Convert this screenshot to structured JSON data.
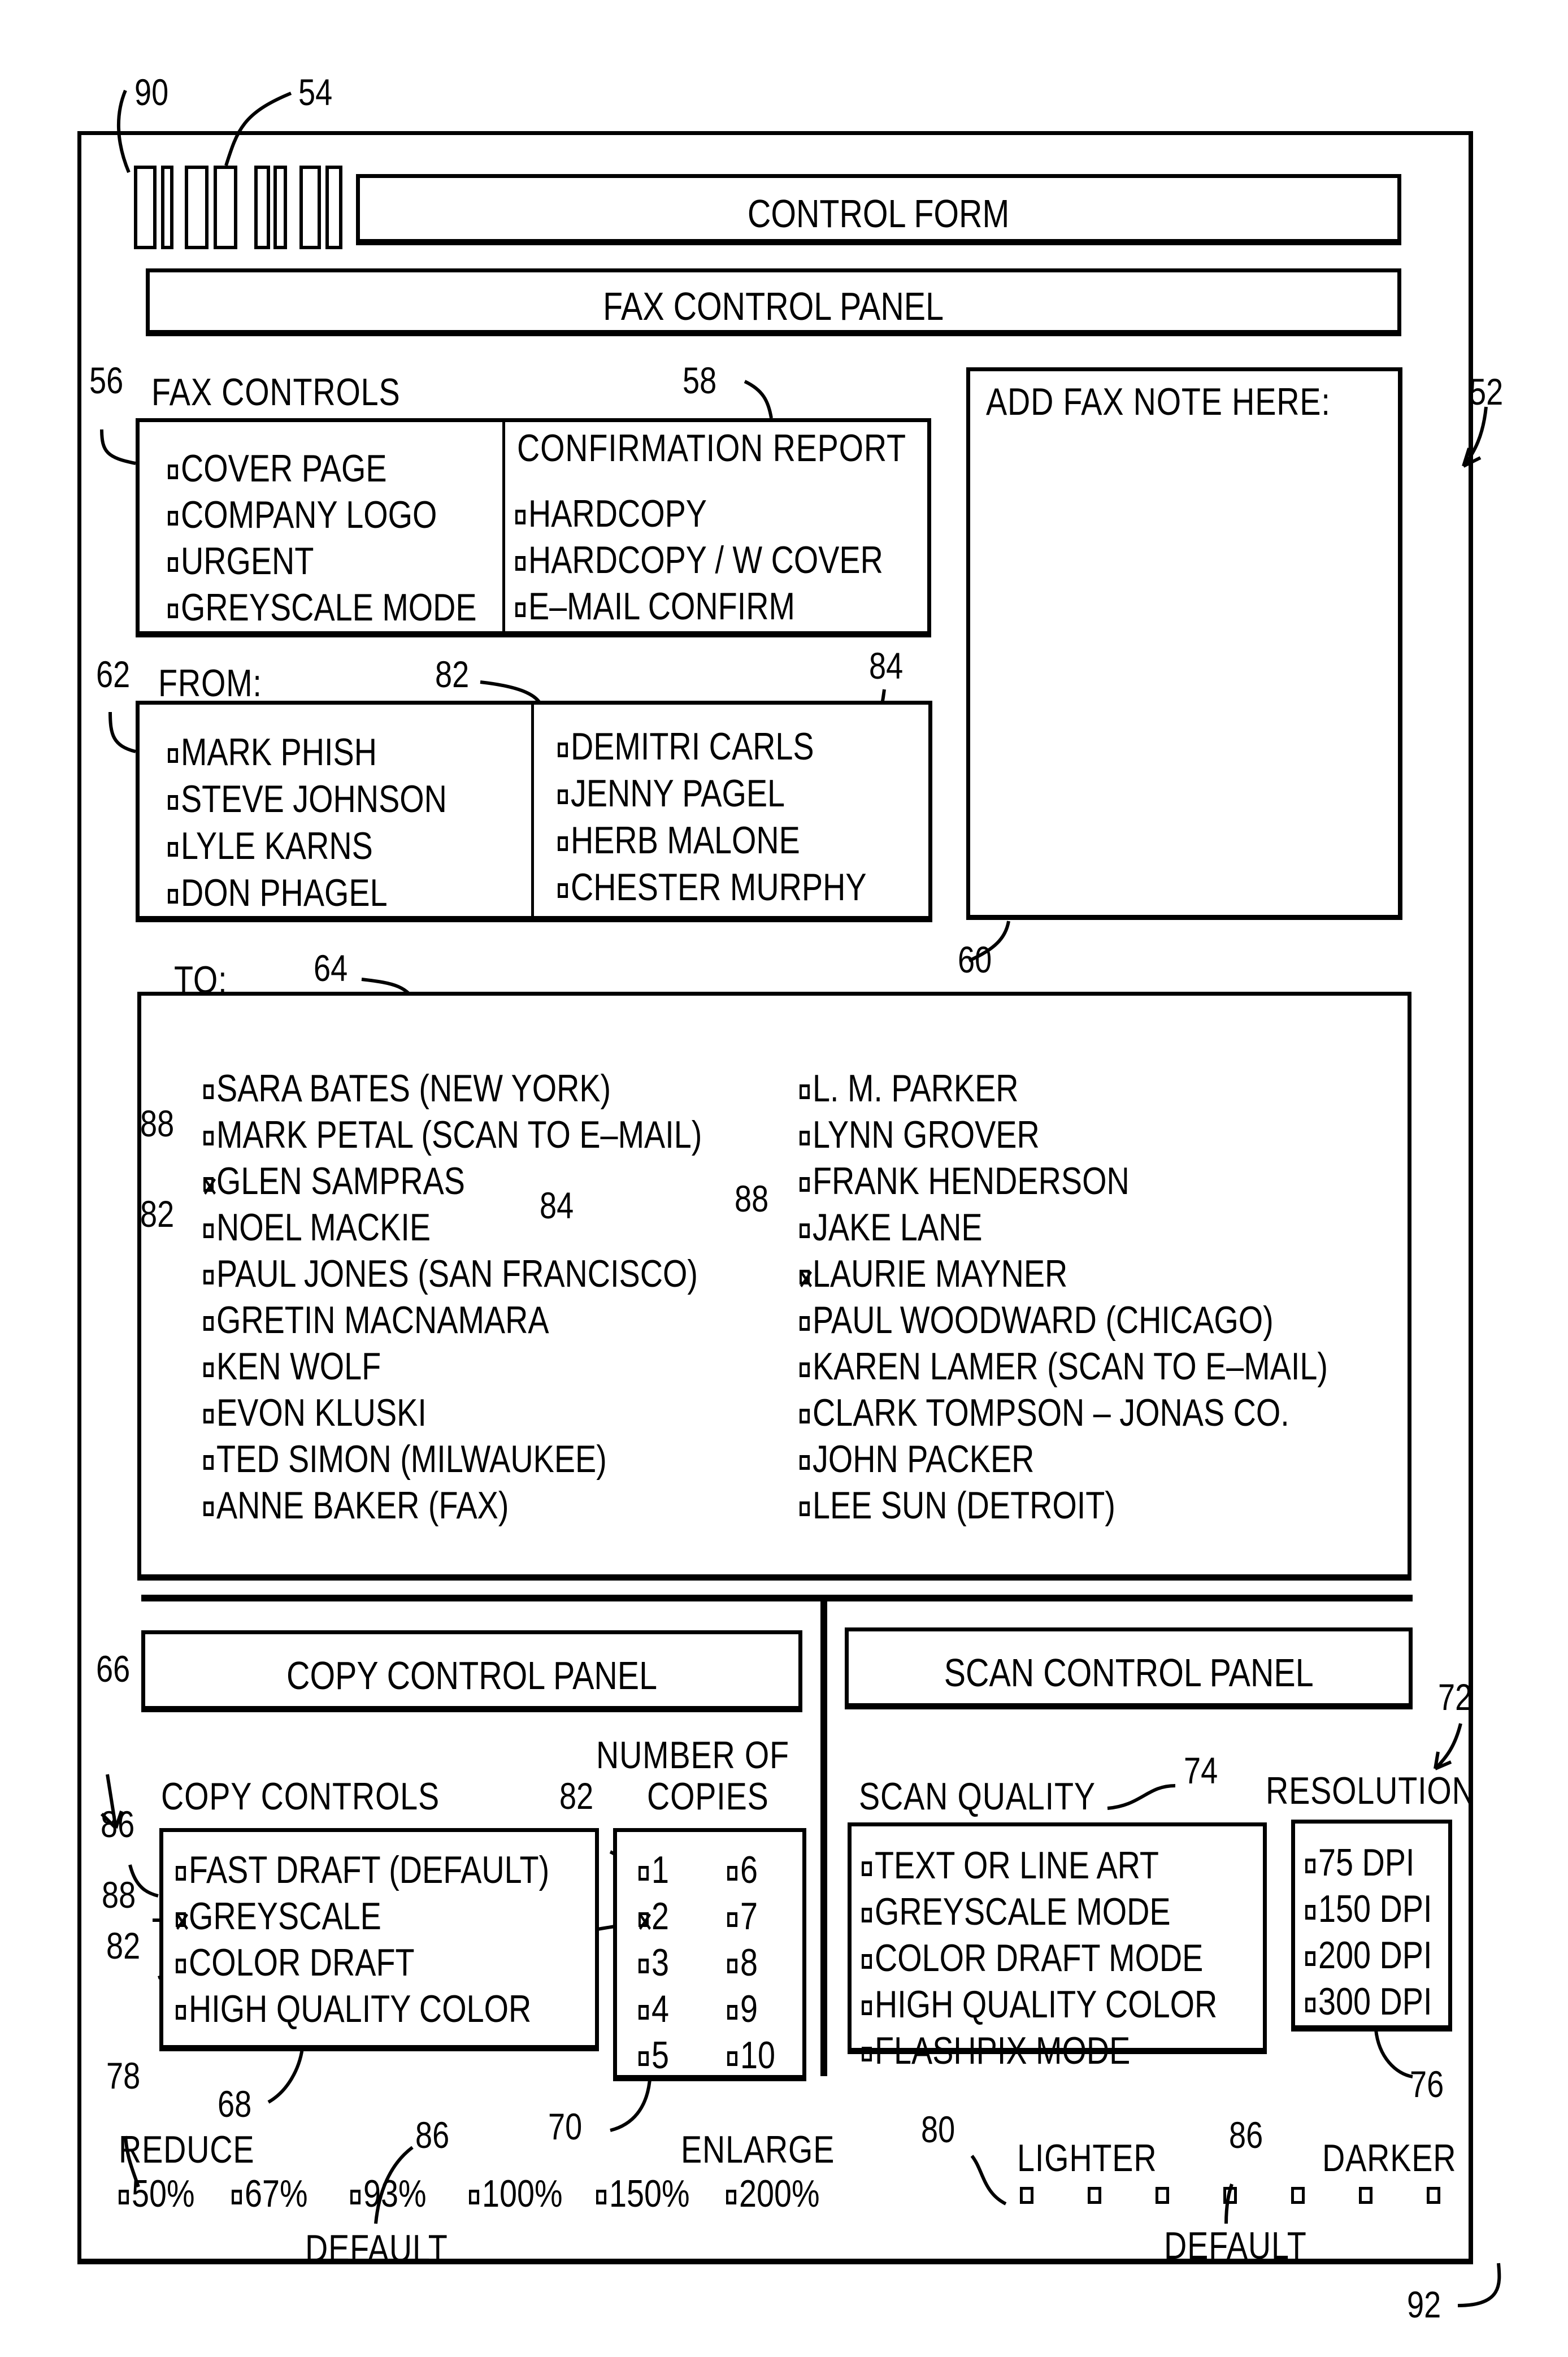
{
  "window": {
    "title": "CONTROL FORM"
  },
  "fax_panel": {
    "title": "FAX CONTROL PANEL",
    "fax_controls": {
      "label": "FAX CONTROLS",
      "items": [
        {
          "label": "COVER PAGE",
          "checked": false
        },
        {
          "label": "COMPANY LOGO",
          "checked": false
        },
        {
          "label": "URGENT",
          "checked": false
        },
        {
          "label": "GREYSCALE MODE",
          "checked": false
        }
      ]
    },
    "confirmation_report": {
      "label": "CONFIRMATION  REPORT",
      "items": [
        {
          "label": "HARDCOPY",
          "checked": false
        },
        {
          "label": "HARDCOPY / W  COVER",
          "checked": false
        },
        {
          "label": "E–MAIL CONFIRM",
          "checked": false
        }
      ]
    },
    "note": {
      "label": "ADD  FAX  NOTE  HERE:",
      "value": ""
    },
    "from": {
      "label": "FROM:",
      "left": [
        {
          "label": "MARK  PHISH",
          "checked": false
        },
        {
          "label": "STEVE  JOHNSON",
          "checked": false
        },
        {
          "label": "LYLE  KARNS",
          "checked": false
        },
        {
          "label": "DON  PHAGEL",
          "checked": false
        }
      ],
      "right": [
        {
          "label": "DEMITRI CARLS",
          "checked": false
        },
        {
          "label": "JENNY  PAGEL",
          "checked": false
        },
        {
          "label": "HERB  MALONE",
          "checked": false
        },
        {
          "label": "CHESTER  MURPHY",
          "checked": false
        }
      ]
    },
    "to": {
      "label": "TO:",
      "left": [
        {
          "label": "SARA  BATES  (NEW   YORK)",
          "checked": false
        },
        {
          "label": "MARK  PETAL  (SCAN  TO  E–MAIL)",
          "checked": false
        },
        {
          "label": "GLEN  SAMPRAS",
          "checked": true
        },
        {
          "label": "NOEL  MACKIE",
          "checked": false
        },
        {
          "label": "PAUL  JONES  (SAN   FRANCISCO)",
          "checked": false
        },
        {
          "label": "GRETIN   MACNAMARA",
          "checked": false
        },
        {
          "label": "KEN  WOLF",
          "checked": false
        },
        {
          "label": "EVON  KLUSKI",
          "checked": false
        },
        {
          "label": "TED  SIMON  (MILWAUKEE)",
          "checked": false
        },
        {
          "label": "ANNE  BAKER  (FAX)",
          "checked": false
        }
      ],
      "right": [
        {
          "label": "L. M. PARKER",
          "checked": false
        },
        {
          "label": "LYNN  GROVER",
          "checked": false
        },
        {
          "label": "FRANK  HENDERSON",
          "checked": false
        },
        {
          "label": "JAKE  LANE",
          "checked": false
        },
        {
          "label": "LAURIE  MAYNER",
          "checked": true
        },
        {
          "label": "PAUL  WOODWARD  (CHICAGO)",
          "checked": false
        },
        {
          "label": "KAREN  LAMER  (SCAN  TO  E–MAIL)",
          "checked": false
        },
        {
          "label": "CLARK  TOMPSON  –  JONAS  CO.",
          "checked": false
        },
        {
          "label": "JOHN  PACKER",
          "checked": false
        },
        {
          "label": "LEE  SUN  (DETROIT)",
          "checked": false
        }
      ]
    }
  },
  "copy_panel": {
    "title": "COPY  CONTROL  PANEL",
    "copy_controls": {
      "label": "COPY  CONTROLS",
      "items": [
        {
          "label": "FAST  DRAFT  (DEFAULT)",
          "checked": false
        },
        {
          "label": "GREYSCALE",
          "checked": true
        },
        {
          "label": "COLOR  DRAFT",
          "checked": false
        },
        {
          "label": "HIGH  QUALITY  COLOR",
          "checked": false
        }
      ]
    },
    "copies": {
      "label_line1": "NUMBER  OF",
      "label_line2": "COPIES",
      "items": [
        {
          "label": "1",
          "checked": false
        },
        {
          "label": "2",
          "checked": true
        },
        {
          "label": "3",
          "checked": false
        },
        {
          "label": "4",
          "checked": false
        },
        {
          "label": "5",
          "checked": false
        },
        {
          "label": "6",
          "checked": false
        },
        {
          "label": "7",
          "checked": false
        },
        {
          "label": "8",
          "checked": false
        },
        {
          "label": "9",
          "checked": false
        },
        {
          "label": "10",
          "checked": false
        }
      ]
    },
    "zoom": {
      "reduce_label": "REDUCE",
      "enlarge_label": "ENLARGE",
      "default_label": "DEFAULT",
      "options": [
        {
          "label": "50%",
          "checked": false
        },
        {
          "label": "67%",
          "checked": false
        },
        {
          "label": "93%",
          "checked": false
        },
        {
          "label": "100%",
          "checked": false
        },
        {
          "label": "150%",
          "checked": false
        },
        {
          "label": "200%",
          "checked": false
        }
      ]
    }
  },
  "scan_panel": {
    "title": "SCAN  CONTROL  PANEL",
    "scan_quality": {
      "label": "SCAN  QUALITY",
      "items": [
        {
          "label": "TEXT  OR  LINE  ART",
          "checked": false
        },
        {
          "label": "GREYSCALE  MODE",
          "checked": false
        },
        {
          "label": "COLOR  DRAFT  MODE",
          "checked": false
        },
        {
          "label": "HIGH  QUALITY  COLOR",
          "checked": false
        },
        {
          "label": "FLASHPIX  MODE",
          "checked": false
        }
      ]
    },
    "resolution": {
      "label": "RESOLUTION",
      "items": [
        {
          "label": "75  DPI",
          "checked": false
        },
        {
          "label": "150  DPI",
          "checked": false
        },
        {
          "label": "200  DPI",
          "checked": false
        },
        {
          "label": "300  DPI",
          "checked": false
        }
      ]
    },
    "density": {
      "lighter_label": "LIGHTER",
      "darker_label": "DARKER",
      "default_label": "DEFAULT",
      "steps": 7,
      "default_step": 4
    }
  },
  "reference_numerals": {
    "r90": "90",
    "r54": "54",
    "r52": "52",
    "r56": "56",
    "r58": "58",
    "r60": "60",
    "r62": "62",
    "r64": "64",
    "r66": "66",
    "r68": "68",
    "r70": "70",
    "r72": "72",
    "r74": "74",
    "r76": "76",
    "r78": "78",
    "r80": "80",
    "r82": "82",
    "r84": "84",
    "r86": "86",
    "r88": "88",
    "r92": "92"
  }
}
